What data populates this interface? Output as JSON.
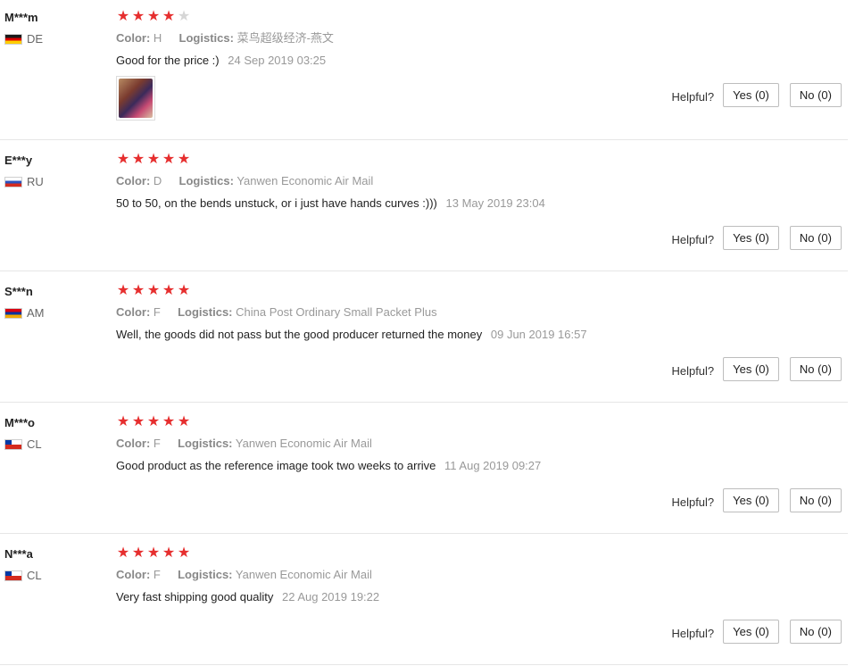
{
  "labels": {
    "color": "Color:",
    "logistics": "Logistics:",
    "helpful": "Helpful?"
  },
  "accent": {
    "star_on": "#e62e2e",
    "star_off": "#d6d6d6"
  },
  "reviews": [
    {
      "user": "M***m",
      "country": "DE",
      "flag_icon": "germany-flag-icon",
      "rating": 4,
      "color": "H",
      "logistics": "菜鸟超级经济-燕文",
      "text": "Good for the price :)",
      "date": "24 Sep 2019 03:25",
      "has_photo": true,
      "yes": "Yes (0)",
      "no": "No (0)"
    },
    {
      "user": "E***y",
      "country": "RU",
      "flag_icon": "russia-flag-icon",
      "rating": 5,
      "color": "D",
      "logistics": "Yanwen Economic Air Mail",
      "text": "50 to 50, on the bends unstuck, or i just have hands curves :)))",
      "date": "13 May 2019 23:04",
      "has_photo": false,
      "yes": "Yes (0)",
      "no": "No (0)"
    },
    {
      "user": "S***n",
      "country": "AM",
      "flag_icon": "armenia-flag-icon",
      "rating": 5,
      "color": "F",
      "logistics": "China Post Ordinary Small Packet Plus",
      "text": "Well, the goods did not pass but the good producer returned the money",
      "date": "09 Jun 2019 16:57",
      "has_photo": false,
      "yes": "Yes (0)",
      "no": "No (0)"
    },
    {
      "user": "M***o",
      "country": "CL",
      "flag_icon": "chile-flag-icon",
      "rating": 5,
      "color": "F",
      "logistics": "Yanwen Economic Air Mail",
      "text": "Good product as the reference image took two weeks to arrive",
      "date": "11 Aug 2019 09:27",
      "has_photo": false,
      "yes": "Yes (0)",
      "no": "No (0)"
    },
    {
      "user": "N***a",
      "country": "CL",
      "flag_icon": "chile-flag-icon",
      "rating": 5,
      "color": "F",
      "logistics": "Yanwen Economic Air Mail",
      "text": "Very fast shipping good quality",
      "date": "22 Aug 2019 19:22",
      "has_photo": false,
      "yes": "Yes (0)",
      "no": "No (0)"
    }
  ]
}
